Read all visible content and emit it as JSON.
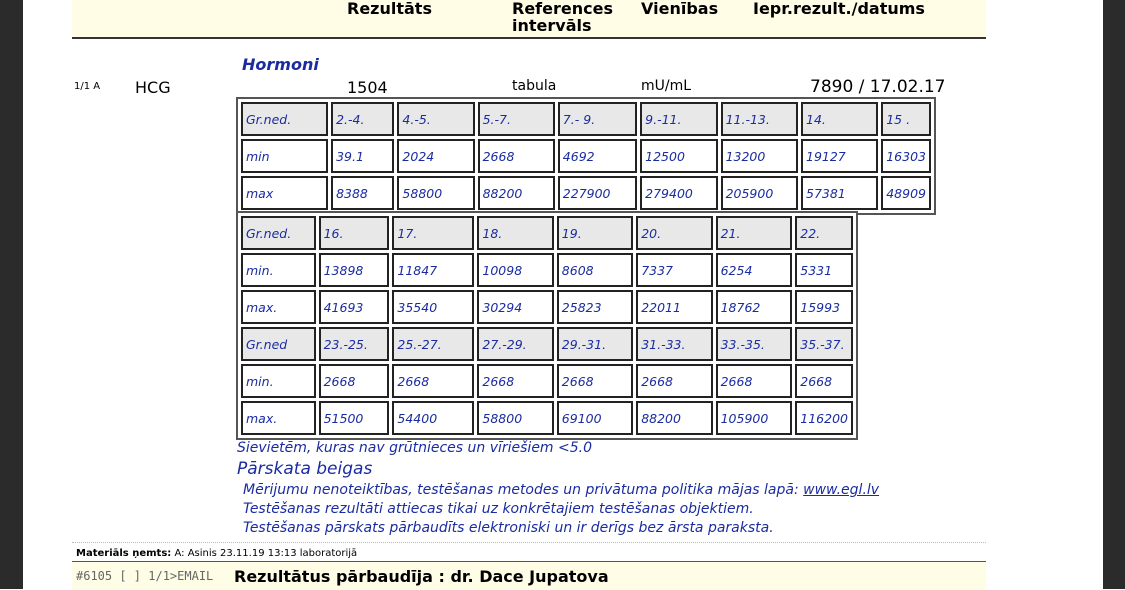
{
  "header": {
    "col_result": "Rezultāts",
    "col_reference": "References\nintervāls",
    "col_units": "Vienības",
    "col_previous": "Iepr.rezult./datums"
  },
  "section": {
    "title": "Hormoni"
  },
  "test_row": {
    "index": "1/1 A",
    "name": "HCG",
    "result": "1504",
    "reference": "tabula",
    "units": "mU/mL",
    "previous": "7890 / 17.02.17"
  },
  "table1": {
    "rows": [
      [
        "Gr.ned.",
        "2.-4.",
        "4.-5.",
        "5.-7.",
        "7.- 9.",
        "9.-11.",
        "11.-13.",
        "14.",
        "15 ."
      ],
      [
        "min",
        "39.1",
        "2024",
        "2668",
        "4692",
        "12500",
        "13200",
        "19127",
        "16303"
      ],
      [
        "max",
        "8388",
        "58800",
        "88200",
        "227900",
        "279400",
        "205900",
        "57381",
        "48909"
      ]
    ]
  },
  "table2": {
    "rows": [
      [
        "Gr.ned.",
        "16.",
        "17.",
        "18.",
        "19.",
        "20.",
        "21.",
        "22."
      ],
      [
        "min.",
        "13898",
        "11847",
        "10098",
        "8608",
        "7337",
        "6254",
        "5331"
      ],
      [
        "max.",
        "41693",
        "35540",
        "30294",
        "25823",
        "22011",
        "18762",
        "15993"
      ],
      [
        "Gr.ned",
        "23.-25.",
        "25.-27.",
        "27.-29.",
        "29.-31.",
        "31.-33.",
        "33.-35.",
        "35.-37."
      ],
      [
        "min.",
        "2668",
        "2668",
        "2668",
        "2668",
        "2668",
        "2668",
        "2668"
      ],
      [
        "max.",
        "51500",
        "54400",
        "58800",
        "69100",
        "88200",
        "105900",
        "116200"
      ]
    ]
  },
  "notes": {
    "non_pregnant": "Sievietēm, kuras nav grūtnieces un vīriešiem <5.0",
    "end_title": "Pārskata beigas",
    "line1_text": "Mērijumu nenoteiktības, testēšanas metodes un privātuma politika mājas lapā: ",
    "line1_link": "www.egl.lv",
    "line2": "Testēšanas rezultāti attiecas tikai uz konkrētajiem testēšanas objektiem.",
    "line3": "Testēšanas pārskats pārbaudīts elektroniski un ir derīgs bez ārsta paraksta."
  },
  "footer": {
    "material_label": "Materiāls ņemts:",
    "material_value": " A: Asinis 23.11.19 13:13 laboratorijā",
    "code": "#6105 [ ] 1/1>EMAIL",
    "verified": "Rezultātus pārbaudīja : dr. Dace Jupatova"
  }
}
